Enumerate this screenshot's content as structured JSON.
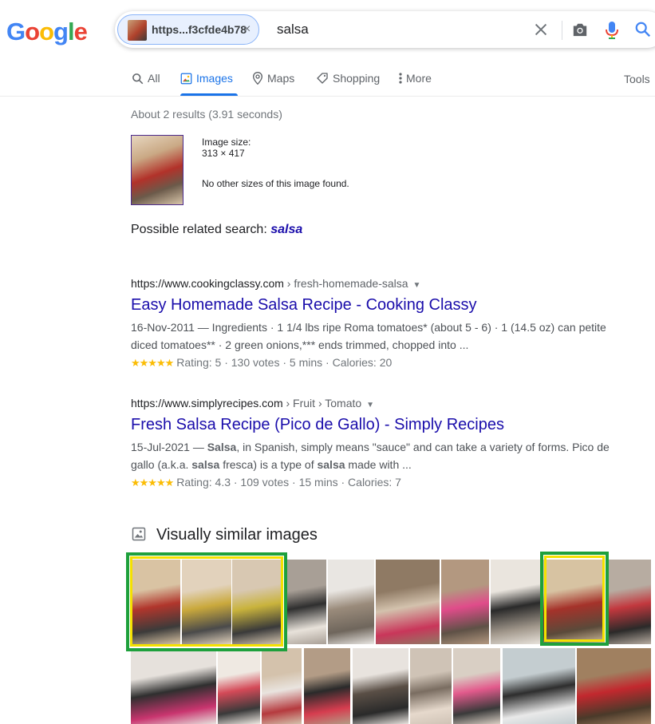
{
  "header": {
    "logo": [
      "G",
      "o",
      "o",
      "g",
      "l",
      "e"
    ],
    "logo_colors": [
      "#4285f4",
      "#ea4335",
      "#fbbc05",
      "#4285f4",
      "#34a853",
      "#ea4335"
    ],
    "chip_label": "https...f3cfde4b78",
    "chip_close": "×",
    "query": "salsa"
  },
  "tabs": {
    "all": "All",
    "images": "Images",
    "maps": "Maps",
    "shopping": "Shopping",
    "more": "More",
    "tools": "Tools"
  },
  "stats": "About 2 results (3.91 seconds)",
  "image_info": {
    "size_label": "Image size:",
    "size_value": "313 × 417",
    "no_other": "No other sizes of this image found."
  },
  "related": {
    "label": "Possible related search: ",
    "link": "salsa"
  },
  "results": [
    {
      "url": "https://www.cookingclassy.com",
      "crumb": " › fresh-homemade-salsa",
      "title": "Easy Homemade Salsa Recipe - Cooking Classy",
      "snippet": "16-Nov-2011 — Ingredients · 1 1/4 lbs ripe Roma tomatoes* (about 5 - 6) · 1 (14.5 oz) can petite diced tomatoes** · 2 green onions,*** ends trimmed, chopped into ...",
      "stars": "★★★★★",
      "rating": "Rating: 5 · 130 votes · 5 mins · Calories: 20"
    },
    {
      "url": "https://www.simplyrecipes.com",
      "crumb": " › Fruit › Tomato",
      "title": "Fresh Salsa Recipe (Pico de Gallo) - Simply Recipes",
      "snippet_parts": [
        "15-Jul-2021 — ",
        "Salsa",
        ", in Spanish, simply means \"sauce\" and can take a variety of forms. Pico de gallo (a.k.a. ",
        "salsa",
        " fresca) is a type of ",
        "salsa",
        " made with ..."
      ],
      "stars": "★★★★★",
      "rating": "Rating: 4.3 · 109 votes · 15 mins · Calories: 7"
    }
  ],
  "similar": {
    "heading": "Visually similar images"
  }
}
